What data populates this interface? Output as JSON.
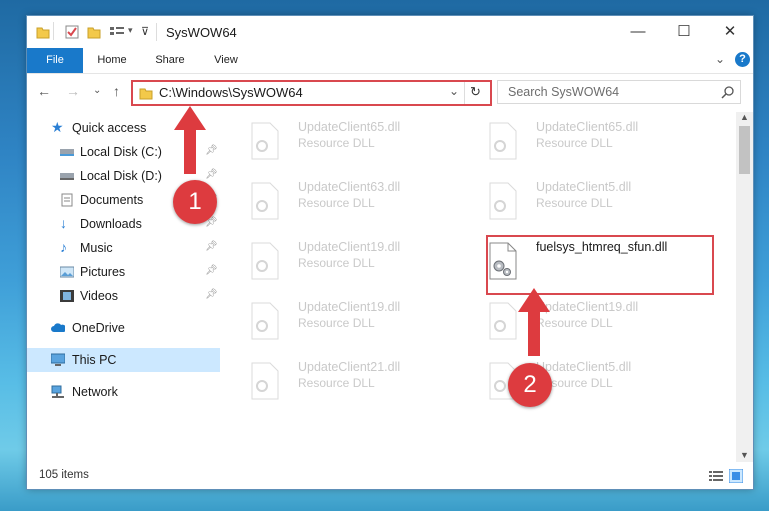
{
  "window": {
    "title": "SysWOW64",
    "controls": {
      "minimize": "—",
      "maximize": "☐",
      "close": "✕"
    }
  },
  "ribbon": {
    "tabs": [
      "File",
      "Home",
      "Share",
      "View"
    ],
    "expand": "⌄",
    "help": "?"
  },
  "address_bar": {
    "path": "C:\\Windows\\SysWOW64",
    "dropdown": "⌄",
    "refresh": "↻"
  },
  "search": {
    "placeholder": "Search SysWOW64"
  },
  "sidebar": {
    "items": [
      {
        "label": "Quick access",
        "icon": "star-icon",
        "pinned": false
      },
      {
        "label": "Local Disk (C:)",
        "icon": "drive-icon",
        "pinned": true
      },
      {
        "label": "Local Disk (D:)",
        "icon": "drive-icon",
        "pinned": true
      },
      {
        "label": "Documents",
        "icon": "documents-icon",
        "pinned": true
      },
      {
        "label": "Downloads",
        "icon": "download-icon",
        "pinned": true
      },
      {
        "label": "Music",
        "icon": "music-icon",
        "pinned": true
      },
      {
        "label": "Pictures",
        "icon": "pictures-icon",
        "pinned": true
      },
      {
        "label": "Videos",
        "icon": "videos-icon",
        "pinned": true
      },
      {
        "label": "OneDrive",
        "icon": "cloud-icon",
        "pinned": false
      },
      {
        "label": "This PC",
        "icon": "computer-icon",
        "pinned": false,
        "selected": true
      },
      {
        "label": "Network",
        "icon": "network-icon",
        "pinned": false
      }
    ]
  },
  "files": [
    {
      "name": "UpdateClient65.dll",
      "type": "Resource DLL",
      "highlighted": false
    },
    {
      "name": "UpdateClient65.dll",
      "type": "Resource DLL",
      "highlighted": false
    },
    {
      "name": "UpdateClient63.dll",
      "type": "Resource DLL",
      "highlighted": false
    },
    {
      "name": "UpdateClient5.dll",
      "type": "Resource DLL",
      "highlighted": false
    },
    {
      "name": "UpdateClient19.dll",
      "type": "Resource DLL",
      "highlighted": false
    },
    {
      "name": "fuelsys_htmreq_sfun.dll",
      "type": "",
      "highlighted": true
    },
    {
      "name": "UpdateClient19.dll",
      "type": "Resource DLL",
      "highlighted": false
    },
    {
      "name": "UpdateClient19.dll",
      "type": "Resource DLL",
      "highlighted": false
    },
    {
      "name": "UpdateClient21.dll",
      "type": "Resource DLL",
      "highlighted": false
    },
    {
      "name": "UpdateClient5.dll",
      "type": "Resource DLL",
      "highlighted": false
    }
  ],
  "status": {
    "item_count": "105 items"
  },
  "markers": {
    "step1": "1",
    "step2": "2"
  },
  "colors": {
    "accent": "#1979ca",
    "highlight": "#d9484f",
    "selected_nav": "#cce8ff"
  }
}
